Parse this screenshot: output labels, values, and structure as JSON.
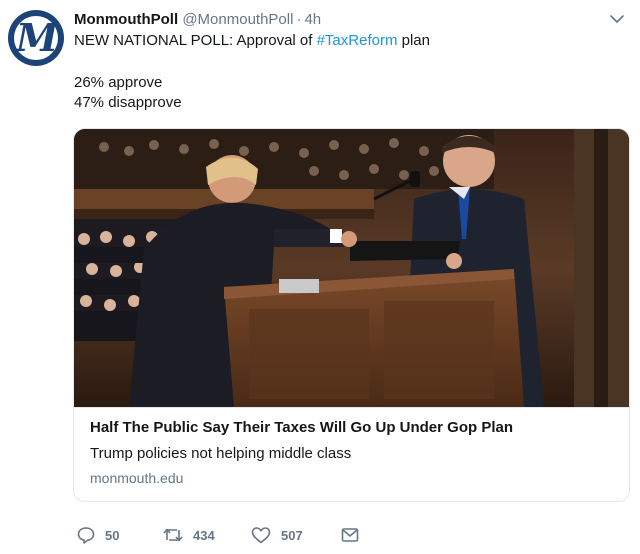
{
  "tweet": {
    "display_name": "MonmouthPoll",
    "handle": "@MonmouthPoll",
    "separator": "·",
    "time": "4h",
    "avatar_letter": "M",
    "text_prefix": "NEW NATIONAL POLL: Approval of ",
    "hashtag": "#TaxReform",
    "text_suffix": " plan",
    "line_approve": "26% approve",
    "line_disapprove": "47% disapprove"
  },
  "card": {
    "title": "Half The Public Say Their Taxes Will Go Up Under Gop Plan",
    "description": "Trump policies not helping middle class",
    "domain": "monmouth.edu",
    "image_icon": "news-photo"
  },
  "actions": {
    "replies": "50",
    "retweets": "434",
    "likes": "507"
  },
  "colors": {
    "accent": "#1b95e0",
    "muted": "#657786",
    "brand": "#1c4478"
  },
  "icons": [
    "reply-icon",
    "retweet-icon",
    "like-icon",
    "direct-message-icon",
    "chevron-down-icon"
  ]
}
